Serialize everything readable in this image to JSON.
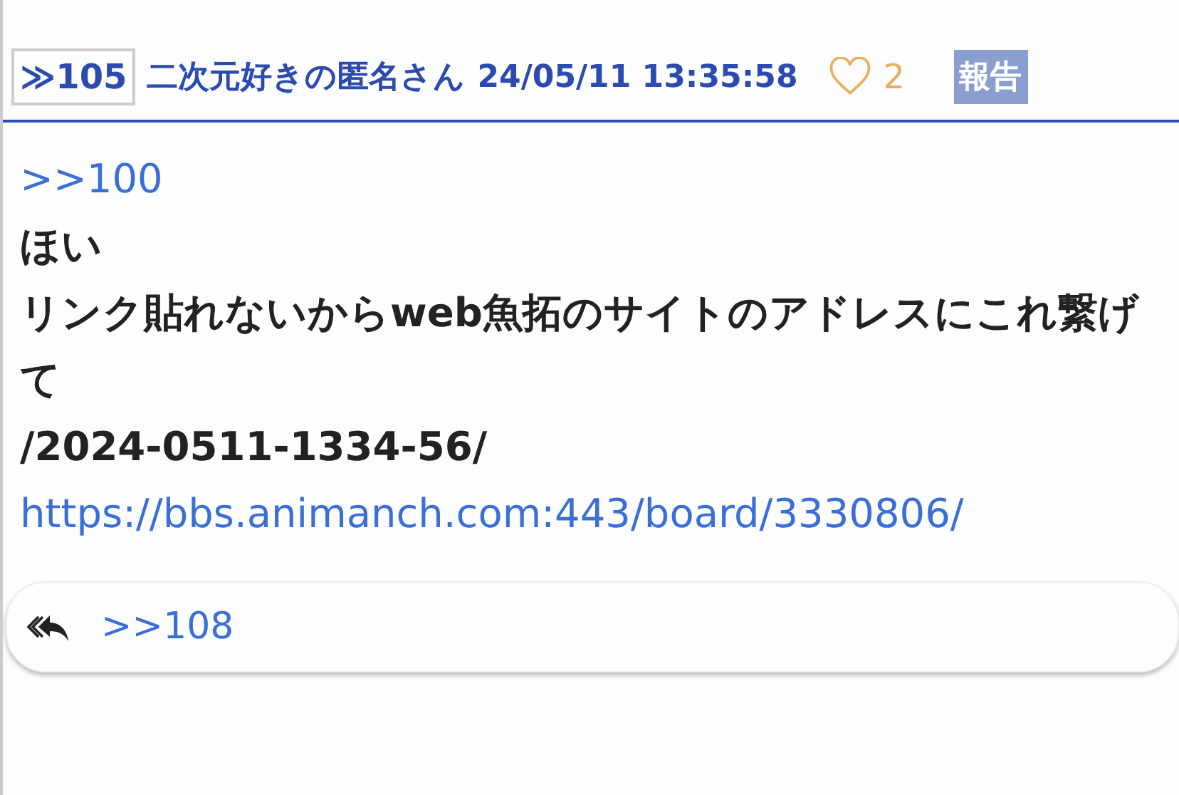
{
  "post": {
    "number": "≫105",
    "author": "二次元好きの匿名さん",
    "datetime": "24/05/11 13:35:58",
    "likes": "2",
    "liked": false,
    "report": "報告",
    "body": [
      {
        "segments": [
          {
            "kind": "link",
            "text": ">>100"
          }
        ]
      },
      {
        "segments": [
          {
            "kind": "text",
            "text": "ほい"
          }
        ]
      },
      {
        "segments": [
          {
            "kind": "text",
            "text": "リンク貼れないからweb魚拓のサイトのアドレスにこれ繋げて"
          }
        ]
      },
      {
        "segments": [
          {
            "kind": "text",
            "text": "/2024-0511-1334-56/"
          },
          {
            "kind": "link",
            "text": "https://bbs.animanch.com:443/board/3330806/"
          }
        ]
      }
    ],
    "replies": [
      ">>108"
    ]
  }
}
